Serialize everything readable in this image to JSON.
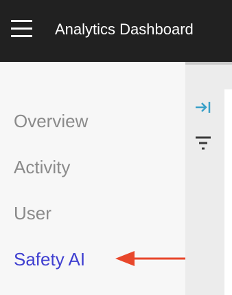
{
  "header": {
    "menu_icon": "hamburger-menu-icon",
    "title": "Analytics Dashboard"
  },
  "sidebar": {
    "items": [
      {
        "label": "Overview",
        "active": false
      },
      {
        "label": "Activity",
        "active": false
      },
      {
        "label": "User",
        "active": false
      },
      {
        "label": "Safety AI",
        "active": true
      }
    ]
  },
  "rail": {
    "icons": [
      "collapse-right-icon",
      "filter-icon"
    ]
  },
  "annotation": {
    "icon": "red-arrow-left-icon",
    "color": "#e8472b"
  },
  "colors": {
    "header_bg": "#212121",
    "active_nav": "#3f3fd0",
    "inactive_nav": "#8a8a8a",
    "rail_icon": "#3aa0c8"
  }
}
